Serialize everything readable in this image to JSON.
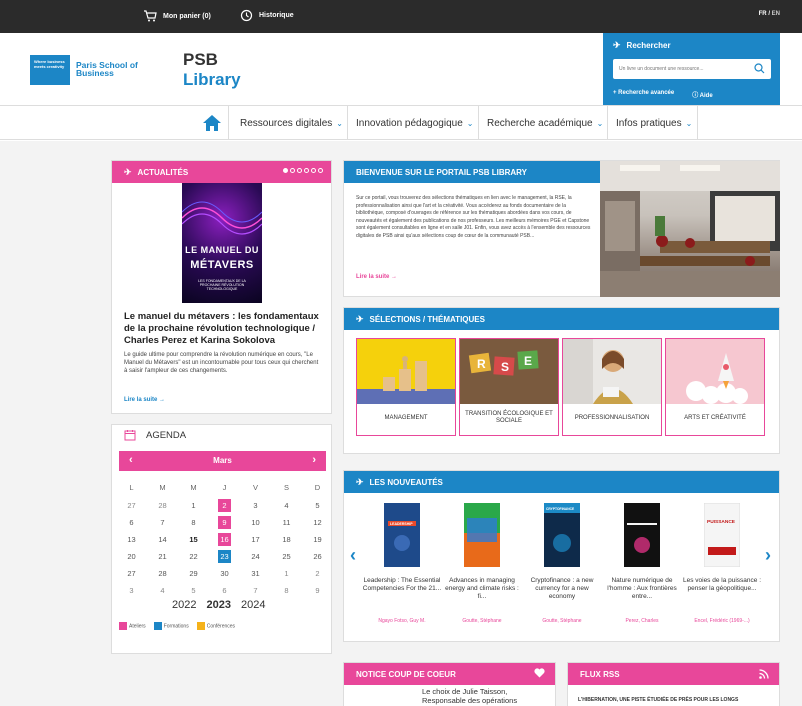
{
  "topbar": {
    "cart_label": "Mon panier (0)",
    "history_label": "Historique",
    "lang_fr": "FR",
    "lang_sep": "/",
    "lang_en": "EN"
  },
  "header": {
    "logo_tagline": "Where business meets creativity",
    "logo_name": "Paris School of Business",
    "library_line1": "PSB",
    "library_line2": "Library"
  },
  "search": {
    "title": "Rechercher",
    "placeholder": "Un livre un document une ressource...",
    "advanced_label": "+ Recherche avancée",
    "help_label": "ⓘ Aide"
  },
  "nav": {
    "items": [
      {
        "label": "Ressources digitales"
      },
      {
        "label": "Innovation pédagogique"
      },
      {
        "label": "Recherche académique"
      },
      {
        "label": "Infos pratiques"
      }
    ]
  },
  "news": {
    "header": "Actualités",
    "book_cover_line1": "LE MANUEL DU",
    "book_cover_line2": "MÉTAVERS",
    "book_cover_line3": "LES FONDAMENTAUX DE LA PROCHAINE RÉVOLUTION TECHNOLOGIQUE",
    "title": "Le manuel du métavers : les fondamentaux de la prochaine révolution technologique / Charles Perez et Karina Sokolova",
    "text": "Le guide ultime pour comprendre la révolution numérique en cours, \"Le Manuel du Métavers\" est un incontournable pour tous ceux qui cherchent à saisir l'ampleur de ces changements.",
    "more": "Lire la suite →"
  },
  "agenda": {
    "header": "AGENDA",
    "month": "Mars",
    "weekdays": [
      "L",
      "M",
      "M",
      "J",
      "V",
      "S",
      "D"
    ],
    "years": [
      "2022",
      "2023",
      "2024"
    ],
    "legend": [
      {
        "label": "Ateliers",
        "color": "#e8479a"
      },
      {
        "label": "Formations",
        "color": "#1c86c6"
      },
      {
        "label": "Conférences",
        "color": "#f5b21a"
      }
    ],
    "weeks": [
      [
        "27",
        "28",
        "1",
        "2",
        "3",
        "4",
        "5"
      ],
      [
        "6",
        "7",
        "8",
        "9",
        "10",
        "11",
        "12"
      ],
      [
        "13",
        "14",
        "15",
        "16",
        "17",
        "18",
        "19"
      ],
      [
        "20",
        "21",
        "22",
        "23",
        "24",
        "25",
        "26"
      ],
      [
        "27",
        "28",
        "29",
        "30",
        "31",
        "1",
        "2"
      ],
      [
        "3",
        "4",
        "5",
        "6",
        "7",
        "8",
        "9"
      ]
    ]
  },
  "welcome": {
    "header": "Bienvenue sur le portail PSB Library",
    "text": "Sur ce portail, vous trouverez des sélections thématiques en lien avec le management, la RSE, la professionnalisation ainsi que l'art et la créativité. Vous accéderez au fonds documentaire de la bibliothèque, composé d'ouvrages de référence sur les thématiques abordées dans vos cours, de nouveautés et également des publications de nos professeurs. Les meilleurs mémoires PGE et Capstone sont également consultables en ligne et en salle J01. Enfin, vous avez accès à l'ensemble des ressources digitales de PSB ainsi qu'aux sélections coup de cœur de la communauté PSB...",
    "more": "Lire la suite →"
  },
  "selections": {
    "header": "Sélections / Thématiques",
    "tiles": [
      {
        "label": "MANAGEMENT"
      },
      {
        "label": "TRANSITION ÉCOLOGIQUE ET SOCIALE"
      },
      {
        "label": "PROFESSIONNALISATION"
      },
      {
        "label": "ARTS et CRÉATIVITÉ"
      }
    ],
    "rse_letters": "RSE"
  },
  "new_arrivals": {
    "header": "Les nouveautés",
    "books": [
      {
        "title": "Leadership : The Essential Competencies For the 21...",
        "author": "Ngayo Fotso, Guy M.",
        "cover": "#1e4a8a"
      },
      {
        "title": "Advances in managing energy and climate risks : fi...",
        "author": "Goutte, Stéphane",
        "cover": "#c33a1f"
      },
      {
        "title": "Cryptofinance : a new currency for a new economy",
        "author": "Goutte, Stéphane",
        "cover": "#1c8ac6"
      },
      {
        "title": "Nature numérique de l'homme : Aux frontières entre...",
        "author": "Perez, Charles",
        "cover": "#1a1a2a"
      },
      {
        "title": "Les voies de la puissance : penser la géopolitique...",
        "author": "Encel, Frédéric (1969-...)",
        "cover": "#f5f5f5"
      }
    ],
    "cover_word_1": "LEADERSHIP",
    "cover_word_3": "CRYPTOFINANCE",
    "cover_word_5": "PUISSANCE"
  },
  "notice": {
    "header": "Notice coup de coeur",
    "text": "Le choix de Julie Taisson, Responsable des opérations"
  },
  "rss": {
    "header": "Flux RSS",
    "text": "L'HIBERNATION, UNE PISTE ÉTUDIÉE DE PRÈS POUR LES LONGS"
  }
}
